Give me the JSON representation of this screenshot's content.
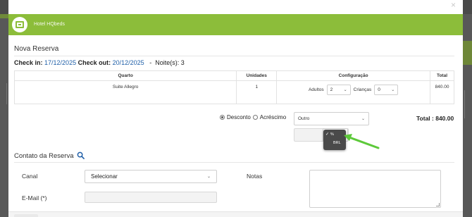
{
  "modal": {
    "close_label": "×",
    "hotel_name": "Hotel HQbeds",
    "title": "Nova Reserva",
    "brand_color": "#8cbd3a"
  },
  "stay": {
    "checkin_label": "Check in:",
    "checkin_value": "17/12/2025",
    "checkout_label": "Check out:",
    "checkout_value": "20/12/2025",
    "separator": "-",
    "nights_label": "Noite(s): 3"
  },
  "rooms_table": {
    "headers": [
      "Quarto",
      "Unidades",
      "Configuração",
      "Total"
    ],
    "rows": [
      {
        "room": "Suite Allegro",
        "units": "1",
        "adults_label": "Adultos",
        "adults_value": "2",
        "children_label": "Crianças",
        "children_value": "0",
        "total": "840.00"
      }
    ]
  },
  "adjustment": {
    "discount_label": "Desconto",
    "surcharge_label": "Acréscimo",
    "selected": "Desconto",
    "reason_value": "Outro",
    "total_label": "Total : 840.00",
    "currency_options": [
      "%",
      "BRL"
    ],
    "currency_selected": "%"
  },
  "contact": {
    "title": "Contato da Reserva",
    "canal_label": "Canal",
    "canal_value": "Selecionar",
    "email_label": "E-Mail (*)",
    "notes_label": "Notas"
  },
  "colors": {
    "link_blue": "#1f5fa8",
    "arrow_green": "#5dc93a"
  }
}
